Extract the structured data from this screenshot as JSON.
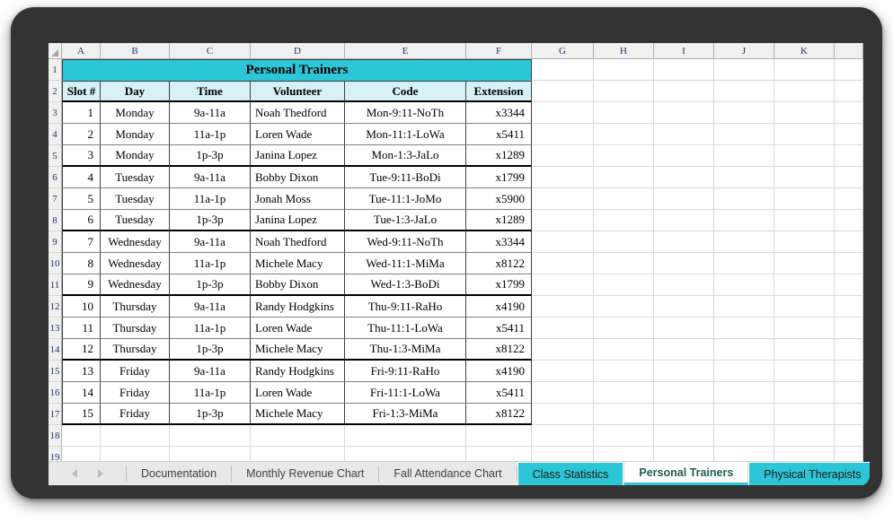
{
  "spreadsheet": {
    "column_headers": [
      "A",
      "B",
      "C",
      "D",
      "E",
      "F",
      "G",
      "H",
      "I",
      "J",
      "K"
    ],
    "title": "Personal Trainers",
    "table_headers": [
      "Slot #",
      "Day",
      "Time",
      "Volunteer",
      "Code",
      "Extension"
    ],
    "rows": [
      {
        "row": "3",
        "slot": "1",
        "day": "Monday",
        "time": "9a-11a",
        "volunteer": "Noah Thedford",
        "code": "Mon-9:11-NoTh",
        "extension": "x3344",
        "group_end": false
      },
      {
        "row": "4",
        "slot": "2",
        "day": "Monday",
        "time": "11a-1p",
        "volunteer": "Loren Wade",
        "code": "Mon-11:1-LoWa",
        "extension": "x5411",
        "group_end": false
      },
      {
        "row": "5",
        "slot": "3",
        "day": "Monday",
        "time": "1p-3p",
        "volunteer": "Janina Lopez",
        "code": "Mon-1:3-JaLo",
        "extension": "x1289",
        "group_end": true
      },
      {
        "row": "6",
        "slot": "4",
        "day": "Tuesday",
        "time": "9a-11a",
        "volunteer": "Bobby Dixon",
        "code": "Tue-9:11-BoDi",
        "extension": "x1799",
        "group_end": false
      },
      {
        "row": "7",
        "slot": "5",
        "day": "Tuesday",
        "time": "11a-1p",
        "volunteer": "Jonah Moss",
        "code": "Tue-11:1-JoMo",
        "extension": "x5900",
        "group_end": false
      },
      {
        "row": "8",
        "slot": "6",
        "day": "Tuesday",
        "time": "1p-3p",
        "volunteer": "Janina Lopez",
        "code": "Tue-1:3-JaLo",
        "extension": "x1289",
        "group_end": true
      },
      {
        "row": "9",
        "slot": "7",
        "day": "Wednesday",
        "time": "9a-11a",
        "volunteer": "Noah Thedford",
        "code": "Wed-9:11-NoTh",
        "extension": "x3344",
        "group_end": false
      },
      {
        "row": "10",
        "slot": "8",
        "day": "Wednesday",
        "time": "11a-1p",
        "volunteer": "Michele Macy",
        "code": "Wed-11:1-MiMa",
        "extension": "x8122",
        "group_end": false
      },
      {
        "row": "11",
        "slot": "9",
        "day": "Wednesday",
        "time": "1p-3p",
        "volunteer": "Bobby Dixon",
        "code": "Wed-1:3-BoDi",
        "extension": "x1799",
        "group_end": true
      },
      {
        "row": "12",
        "slot": "10",
        "day": "Thursday",
        "time": "9a-11a",
        "volunteer": "Randy Hodgkins",
        "code": "Thu-9:11-RaHo",
        "extension": "x4190",
        "group_end": false
      },
      {
        "row": "13",
        "slot": "11",
        "day": "Thursday",
        "time": "11a-1p",
        "volunteer": "Loren Wade",
        "code": "Thu-11:1-LoWa",
        "extension": "x5411",
        "group_end": false
      },
      {
        "row": "14",
        "slot": "12",
        "day": "Thursday",
        "time": "1p-3p",
        "volunteer": "Michele Macy",
        "code": "Thu-1:3-MiMa",
        "extension": "x8122",
        "group_end": true
      },
      {
        "row": "15",
        "slot": "13",
        "day": "Friday",
        "time": "9a-11a",
        "volunteer": "Randy Hodgkins",
        "code": "Fri-9:11-RaHo",
        "extension": "x4190",
        "group_end": false
      },
      {
        "row": "16",
        "slot": "14",
        "day": "Friday",
        "time": "11a-1p",
        "volunteer": "Loren Wade",
        "code": "Fri-11:1-LoWa",
        "extension": "x5411",
        "group_end": false
      },
      {
        "row": "17",
        "slot": "15",
        "day": "Friday",
        "time": "1p-3p",
        "volunteer": "Michele Macy",
        "code": "Fri-1:3-MiMa",
        "extension": "x8122",
        "group_end": true
      }
    ],
    "title_row_number": "1",
    "header_row_number": "2",
    "empty_row_numbers": [
      "18",
      "19"
    ],
    "colors": {
      "title_fill": "#2dc6d6",
      "header_fill": "#d7f0f5",
      "active_tab_text": "#215e52",
      "tab_fill": "#2dc6d6"
    }
  },
  "tabbar": {
    "nav_prev": "previous-sheet-arrow",
    "nav_next": "next-sheet-arrow",
    "tabs": [
      {
        "label": "Documentation",
        "state": "plain"
      },
      {
        "label": "Monthly Revenue Chart",
        "state": "plain"
      },
      {
        "label": "Fall Attendance Chart",
        "state": "plain"
      },
      {
        "label": "Class Statistics",
        "state": "colored"
      },
      {
        "label": "Personal Trainers",
        "state": "active"
      },
      {
        "label": "Physical Therapists",
        "state": "colored"
      }
    ]
  }
}
